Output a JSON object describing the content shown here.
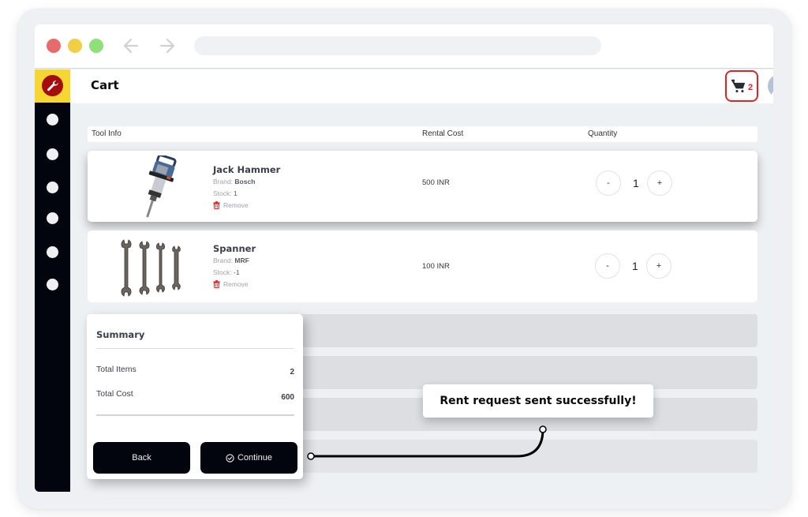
{
  "app": {
    "title": "Cart"
  },
  "browser": {
    "url": ""
  },
  "header": {
    "cart_count": "2"
  },
  "table": {
    "columns": [
      "Tool Info",
      "Rental Cost",
      "Quantity"
    ]
  },
  "items": [
    {
      "name": "Jack Hammer",
      "brand_label": "Brand:",
      "brand": "Bosch",
      "stock_label": "Stock:",
      "stock": "1",
      "remove_label": "Remove",
      "cost": "500 INR",
      "quantity": "1",
      "image": "jack-hammer-image"
    },
    {
      "name": "Spanner",
      "brand_label": "Brand:",
      "brand": "MRF",
      "stock_label": "Stock:",
      "stock": "-1",
      "remove_label": "Remove",
      "cost": "100 INR",
      "quantity": "1",
      "image": "spanner-set-image"
    }
  ],
  "qty_controls": {
    "decrement": "-",
    "increment": "+"
  },
  "summary": {
    "title": "Summary",
    "total_items_label": "Total Items",
    "total_items": "2",
    "total_cost_label": "Total Cost",
    "total_cost": "600",
    "back_label": "Back",
    "continue_label": "Continue"
  },
  "toast": {
    "message": "Rent request sent successfully!"
  },
  "icons": {
    "logo": "wrench-icon",
    "cart": "shopping-cart-icon",
    "avatar": "user-avatar-icon",
    "remove": "trash-icon",
    "continue": "check-circle-icon"
  },
  "colors": {
    "accent_yellow": "#f6d632",
    "logo_red": "#a50d0d",
    "alert_red": "#e02424",
    "sidebar_dark": "#03050e",
    "button_dark": "#03050e"
  }
}
